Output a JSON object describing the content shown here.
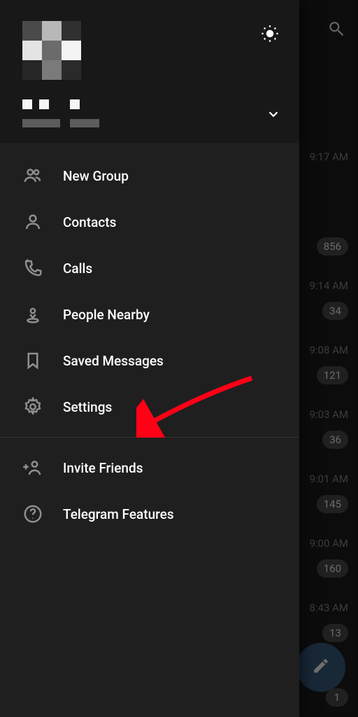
{
  "drawer": {
    "menu": [
      {
        "icon": "group-icon",
        "label": "New Group"
      },
      {
        "icon": "person-icon",
        "label": "Contacts"
      },
      {
        "icon": "phone-icon",
        "label": "Calls"
      },
      {
        "icon": "nearby-icon",
        "label": "People Nearby"
      },
      {
        "icon": "bookmark-icon",
        "label": "Saved Messages"
      },
      {
        "icon": "gear-icon",
        "label": "Settings"
      }
    ],
    "secondary": [
      {
        "icon": "invite-icon",
        "label": "Invite Friends"
      },
      {
        "icon": "help-icon",
        "label": "Telegram Features"
      }
    ]
  },
  "chats": [
    {
      "time": "",
      "badge": ""
    },
    {
      "time": "9:17 AM",
      "badge": ""
    },
    {
      "time": "",
      "badge": "856"
    },
    {
      "time": "9:14 AM",
      "badge": "34"
    },
    {
      "time": "9:08 AM",
      "badge": "121"
    },
    {
      "time": "9:03 AM",
      "badge": "36"
    },
    {
      "time": "9:01 AM",
      "badge": "145"
    },
    {
      "time": "9:00 AM",
      "badge": "160"
    },
    {
      "time": "8:43 AM",
      "badge": "13"
    },
    {
      "time": "",
      "badge": "1"
    }
  ],
  "annotation": {
    "target": "Settings"
  }
}
